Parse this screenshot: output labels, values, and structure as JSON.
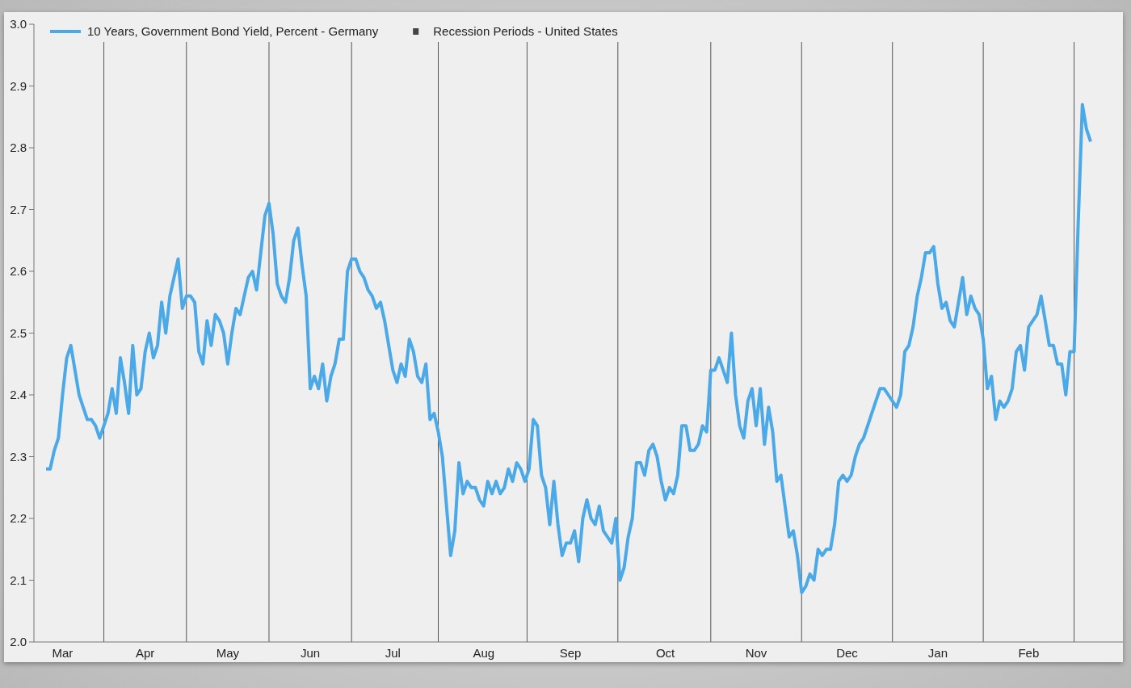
{
  "legend": [
    {
      "kind": "square",
      "label": "Recession Periods - United States",
      "color": "#444444"
    }
  ],
  "chart_data": {
    "type": "line",
    "ylim": [
      2.0,
      3.0
    ],
    "yticks": [
      {
        "value": 2.0,
        "label": "2.0"
      },
      {
        "value": 2.1,
        "label": "2.1"
      },
      {
        "value": 2.2,
        "label": "2.2"
      },
      {
        "value": 2.3,
        "label": "2.3"
      },
      {
        "value": 2.4,
        "label": "2.4"
      },
      {
        "value": 2.5,
        "label": "2.5"
      },
      {
        "value": 2.6,
        "label": "2.6"
      },
      {
        "value": 2.7,
        "label": "2.7"
      },
      {
        "value": 2.8,
        "label": "2.8"
      },
      {
        "value": 2.9,
        "label": "2.9"
      },
      {
        "value": 3.0,
        "label": "3.0"
      }
    ],
    "categories": [
      null,
      null,
      null,
      null,
      "Mar",
      null,
      null,
      null,
      null,
      null,
      null,
      null,
      null,
      null,
      null,
      null,
      null,
      null,
      null,
      null,
      null,
      null,
      null,
      null,
      "Apr",
      null,
      null,
      null,
      null,
      null,
      null,
      null,
      null,
      null,
      null,
      null,
      null,
      null,
      null,
      null,
      null,
      null,
      null,
      null,
      "May",
      null,
      null,
      null,
      null,
      null,
      null,
      null,
      null,
      null,
      null,
      null,
      null,
      null,
      null,
      null,
      null,
      null,
      null,
      null,
      "Jun",
      null,
      null,
      null,
      null,
      null,
      null,
      null,
      null,
      null,
      null,
      null,
      null,
      null,
      null,
      null,
      null,
      null,
      null,
      null,
      "Jul",
      null,
      null,
      null,
      null,
      null,
      null,
      null,
      null,
      null,
      null,
      null,
      null,
      null,
      null,
      null,
      null,
      null,
      null,
      null,
      null,
      null,
      "Aug",
      null,
      null,
      null,
      null,
      null,
      null,
      null,
      null,
      null,
      null,
      null,
      null,
      null,
      null,
      null,
      null,
      null,
      null,
      null,
      null,
      "Sep",
      null,
      null,
      null,
      null,
      null,
      null,
      null,
      null,
      null,
      null,
      null,
      null,
      null,
      null,
      null,
      null,
      null,
      null,
      null,
      null,
      null,
      null,
      "Oct",
      null,
      null,
      null,
      null,
      null,
      null,
      null,
      null,
      null,
      null,
      null,
      null,
      null,
      null,
      null,
      null,
      null,
      null,
      null,
      null,
      null,
      "Nov",
      null,
      null,
      null,
      null,
      null,
      null,
      null,
      null,
      null,
      null,
      null,
      null,
      null,
      null,
      null,
      null,
      null,
      null,
      null,
      null,
      null,
      "Dec",
      null,
      null,
      null,
      null,
      null,
      null,
      null,
      null,
      null,
      null,
      null,
      null,
      null,
      null,
      null,
      null,
      null,
      null,
      null,
      null,
      null,
      "Jan",
      null,
      null,
      null,
      null,
      null,
      null,
      null,
      null,
      null,
      null,
      null,
      null,
      null,
      null,
      null,
      null,
      null,
      null,
      null,
      null,
      null,
      "Feb",
      null,
      null,
      null,
      null,
      null,
      null,
      null,
      null,
      null,
      null,
      null,
      null,
      null,
      null,
      null
    ],
    "series": [
      {
        "name": "10 Years, Government Bond Yield, Percent - Germany",
        "color": "#4aa9e6",
        "values": [
          2.28,
          2.28,
          2.31,
          2.33,
          2.4,
          2.46,
          2.48,
          2.44,
          2.4,
          2.38,
          2.36,
          2.36,
          2.35,
          2.33,
          2.35,
          2.37,
          2.41,
          2.37,
          2.46,
          2.42,
          2.37,
          2.48,
          2.4,
          2.41,
          2.47,
          2.5,
          2.46,
          2.48,
          2.55,
          2.5,
          2.56,
          2.59,
          2.62,
          2.54,
          2.56,
          2.56,
          2.55,
          2.47,
          2.45,
          2.52,
          2.48,
          2.53,
          2.52,
          2.5,
          2.45,
          2.5,
          2.54,
          2.53,
          2.56,
          2.59,
          2.6,
          2.57,
          2.63,
          2.69,
          2.71,
          2.66,
          2.58,
          2.56,
          2.55,
          2.59,
          2.65,
          2.67,
          2.61,
          2.56,
          2.41,
          2.43,
          2.41,
          2.45,
          2.39,
          2.43,
          2.45,
          2.49,
          2.49,
          2.6,
          2.62,
          2.62,
          2.6,
          2.59,
          2.57,
          2.56,
          2.54,
          2.55,
          2.52,
          2.48,
          2.44,
          2.42,
          2.45,
          2.43,
          2.49,
          2.47,
          2.43,
          2.42,
          2.45,
          2.36,
          2.37,
          2.34,
          2.3,
          2.22,
          2.14,
          2.18,
          2.29,
          2.24,
          2.26,
          2.25,
          2.25,
          2.23,
          2.22,
          2.26,
          2.24,
          2.26,
          2.24,
          2.25,
          2.28,
          2.26,
          2.29,
          2.28,
          2.26,
          2.28,
          2.36,
          2.35,
          2.27,
          2.25,
          2.19,
          2.26,
          2.19,
          2.14,
          2.16,
          2.16,
          2.18,
          2.13,
          2.2,
          2.23,
          2.2,
          2.19,
          2.22,
          2.18,
          2.17,
          2.16,
          2.2,
          2.1,
          2.12,
          2.17,
          2.2,
          2.29,
          2.29,
          2.27,
          2.31,
          2.32,
          2.3,
          2.26,
          2.23,
          2.25,
          2.24,
          2.27,
          2.35,
          2.35,
          2.31,
          2.31,
          2.32,
          2.35,
          2.34,
          2.44,
          2.44,
          2.46,
          2.44,
          2.42,
          2.5,
          2.4,
          2.35,
          2.33,
          2.39,
          2.41,
          2.35,
          2.41,
          2.32,
          2.38,
          2.34,
          2.26,
          2.27,
          2.22,
          2.17,
          2.18,
          2.14,
          2.08,
          2.09,
          2.11,
          2.1,
          2.15,
          2.14,
          2.15,
          2.15,
          2.19,
          2.26,
          2.27,
          2.26,
          2.27,
          2.3,
          2.32,
          2.33,
          2.35,
          2.37,
          2.39,
          2.41,
          2.41,
          2.4,
          2.39,
          2.38,
          2.4,
          2.47,
          2.48,
          2.51,
          2.56,
          2.59,
          2.63,
          2.63,
          2.64,
          2.58,
          2.54,
          2.55,
          2.52,
          2.51,
          2.55,
          2.59,
          2.53,
          2.56,
          2.54,
          2.53,
          2.49,
          2.41,
          2.43,
          2.36,
          2.39,
          2.38,
          2.39,
          2.41,
          2.47,
          2.48,
          2.44,
          2.51,
          2.52,
          2.53,
          2.56,
          2.52,
          2.48,
          2.48,
          2.45,
          2.45,
          2.4,
          2.47,
          2.47,
          2.68,
          2.87,
          2.83,
          2.81
        ]
      }
    ]
  }
}
